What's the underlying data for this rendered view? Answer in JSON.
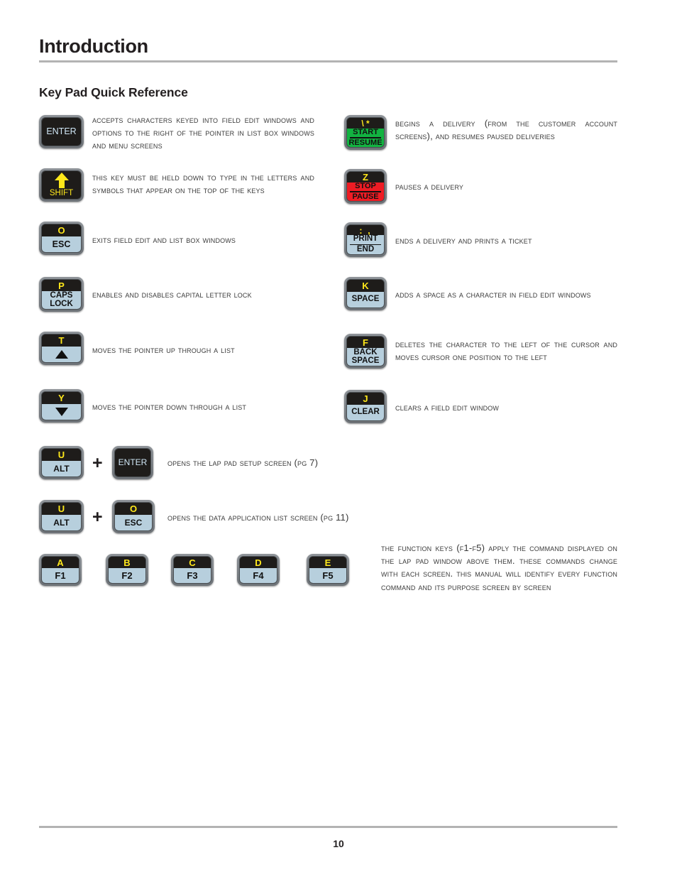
{
  "document": {
    "chapter_title": "Introduction",
    "section_title": "Key Pad Quick Reference",
    "page_number": "10"
  },
  "left_column": [
    {
      "key": {
        "type": "solid",
        "label": "ENTER",
        "top_char": "",
        "bottom_lines": []
      },
      "description": "Accepts characters keyed into field edit windows and options to the right of the pointer in list box windows and menu screens"
    },
    {
      "key": {
        "type": "solid-arrow",
        "label": "SHIFT",
        "top_char": "",
        "bottom_lines": []
      },
      "description": "This key must be held down to type in the letters and symbols that appear on the top of the keys"
    },
    {
      "key": {
        "type": "split",
        "top_char": "O",
        "bottom_lines": [
          "ESC"
        ]
      },
      "description": "Exits field edit and list box windows"
    },
    {
      "key": {
        "type": "split",
        "top_char": "P",
        "bottom_lines": [
          "CAPS",
          "LOCK"
        ]
      },
      "description": "Enables and disables capital letter lock"
    },
    {
      "key": {
        "type": "split-up-arrow",
        "top_char": "T",
        "bottom_lines": []
      },
      "description": "Moves the pointer up through a list"
    },
    {
      "key": {
        "type": "split-down-arrow",
        "top_char": "Y",
        "bottom_lines": []
      },
      "description": "Moves the pointer down through a list"
    }
  ],
  "right_column": [
    {
      "key": {
        "type": "split",
        "color": "green",
        "top_char": "\\ *",
        "bottom_lines": [
          "START",
          "RESUME"
        ]
      },
      "description": "Begins a delivery (from the customer account screens), and resumes paused deliveries"
    },
    {
      "key": {
        "type": "split",
        "color": "red",
        "top_char": "Z",
        "bottom_lines": [
          "STOP",
          "PAUSE"
        ]
      },
      "description": "pauses a delivery"
    },
    {
      "key": {
        "type": "split",
        "top_char": ": ,",
        "bottom_lines": [
          "PRINT",
          "END"
        ]
      },
      "description": "Ends a delivery and prints a ticket"
    },
    {
      "key": {
        "type": "split",
        "top_char": "K",
        "bottom_lines": [
          "SPACE"
        ]
      },
      "description": "Adds a space as a character in field edit windows"
    },
    {
      "key": {
        "type": "split",
        "top_char": "F",
        "bottom_lines": [
          "BACK",
          "SPACE"
        ]
      },
      "description": "Deletes the character to the left of the cursor and moves cursor one position to the left"
    },
    {
      "key": {
        "type": "split",
        "top_char": "J",
        "bottom_lines": [
          "CLEAR"
        ]
      },
      "description": "Clears a field edit window"
    }
  ],
  "combos": [
    {
      "first_key": {
        "top_char": "U",
        "bottom_lines": [
          "ALT"
        ]
      },
      "plus": "+",
      "second_key": {
        "type": "solid",
        "label": "ENTER"
      },
      "description": "Opens the Lap Pad Setup screen (pg 7)"
    },
    {
      "first_key": {
        "top_char": "U",
        "bottom_lines": [
          "ALT"
        ]
      },
      "plus": "+",
      "second_key": {
        "type": "split",
        "top_char": "O",
        "bottom_lines": [
          "ESC"
        ]
      },
      "description": "Opens the Data Application List screen (pg 11)"
    }
  ],
  "function_keys": {
    "keys": [
      {
        "top_char": "A",
        "bottom_lines": [
          "F1"
        ]
      },
      {
        "top_char": "B",
        "bottom_lines": [
          "F2"
        ]
      },
      {
        "top_char": "C",
        "bottom_lines": [
          "F3"
        ]
      },
      {
        "top_char": "D",
        "bottom_lines": [
          "F4"
        ]
      },
      {
        "top_char": "E",
        "bottom_lines": [
          "F5"
        ]
      }
    ],
    "description": "The Function Keys (F1-F5) apply the command displayed on the lap pad window above them. These commands change with each screen. This manual will identify every function command and its purpose screen by screen"
  },
  "colors": {
    "key_yellow": "#ffe81a",
    "key_face": "#b7cfdd",
    "key_dark": "#1e1c1a",
    "key_bezel": "#7c8186",
    "green": "#12b341",
    "red": "#ee1c24",
    "rule": "#b3b3b3"
  }
}
